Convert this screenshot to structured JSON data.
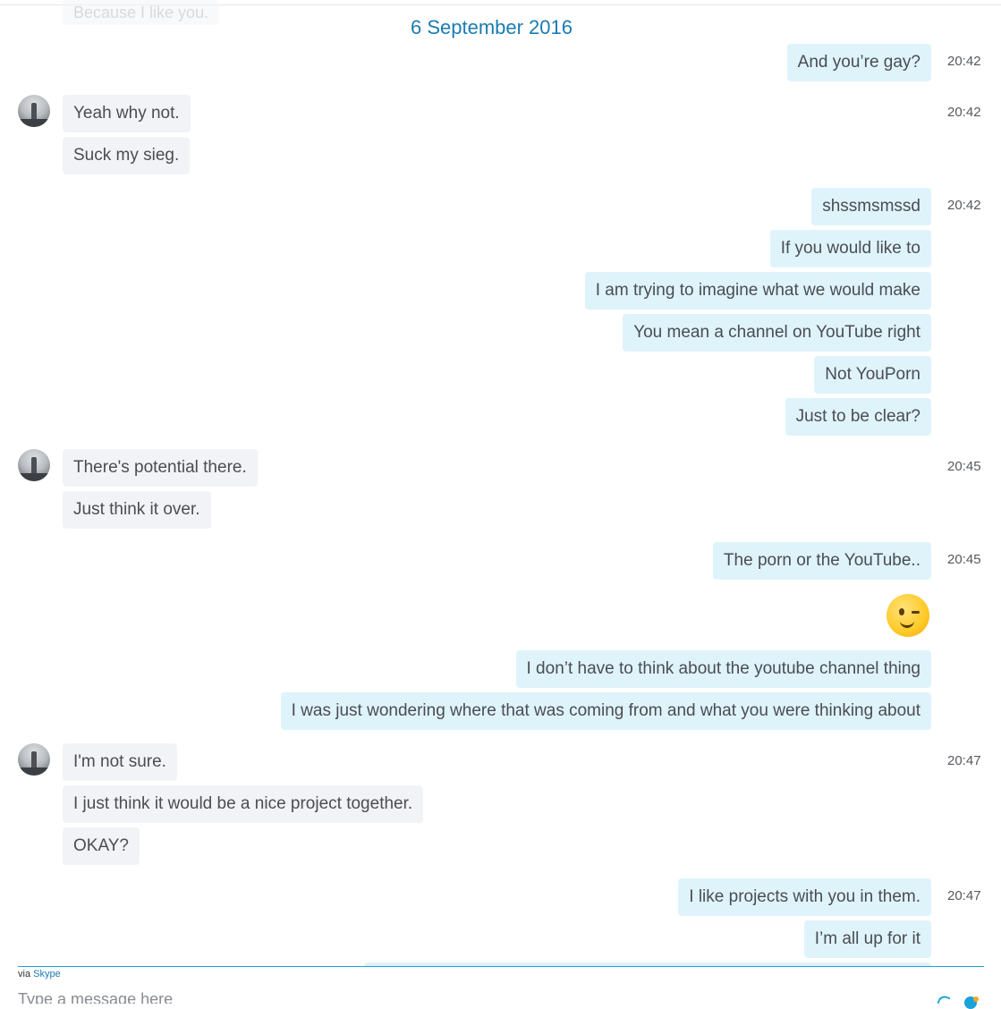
{
  "faded_prev": "Because I like you.",
  "date_header": "6 September 2016",
  "messages": [
    {
      "text": "And you’re gay?",
      "time": "20:42"
    },
    {
      "text": "Yeah why not.",
      "time": "20:42"
    },
    {
      "text": "Suck my sieg."
    },
    {
      "text": "shssmsmssd",
      "time": "20:42"
    },
    {
      "text": "If you would like to"
    },
    {
      "text": "I am trying to imagine what we would make"
    },
    {
      "text": "You mean a channel on YouTube right"
    },
    {
      "text": "Not YouPorn"
    },
    {
      "text": "Just to be clear?"
    },
    {
      "text": "There's potential there.",
      "time": "20:45"
    },
    {
      "text": "Just think it over."
    },
    {
      "text": "The porn or the YouTube..",
      "time": "20:45"
    },
    {
      "text": "I don’t have to think about the youtube channel thing"
    },
    {
      "text": "I was just wondering where that was coming from and what you were thinking about"
    },
    {
      "text": "I'm not sure.",
      "time": "20:47"
    },
    {
      "text": "I just think it would be a nice project together."
    },
    {
      "text": "OKAY?"
    },
    {
      "text": "I like projects with you in them.",
      "time": "20:47"
    },
    {
      "text": "I’m all up for it"
    }
  ],
  "emoji_sticker": "wink-emoji",
  "footer": {
    "via_prefix": "via",
    "via_link": "Skype",
    "compose_placeholder": "Type a message here"
  },
  "colors": {
    "accent": "#1a7cb2",
    "outgoing_bubble": "#dff3fb",
    "incoming_bubble": "#f1f3f6"
  }
}
